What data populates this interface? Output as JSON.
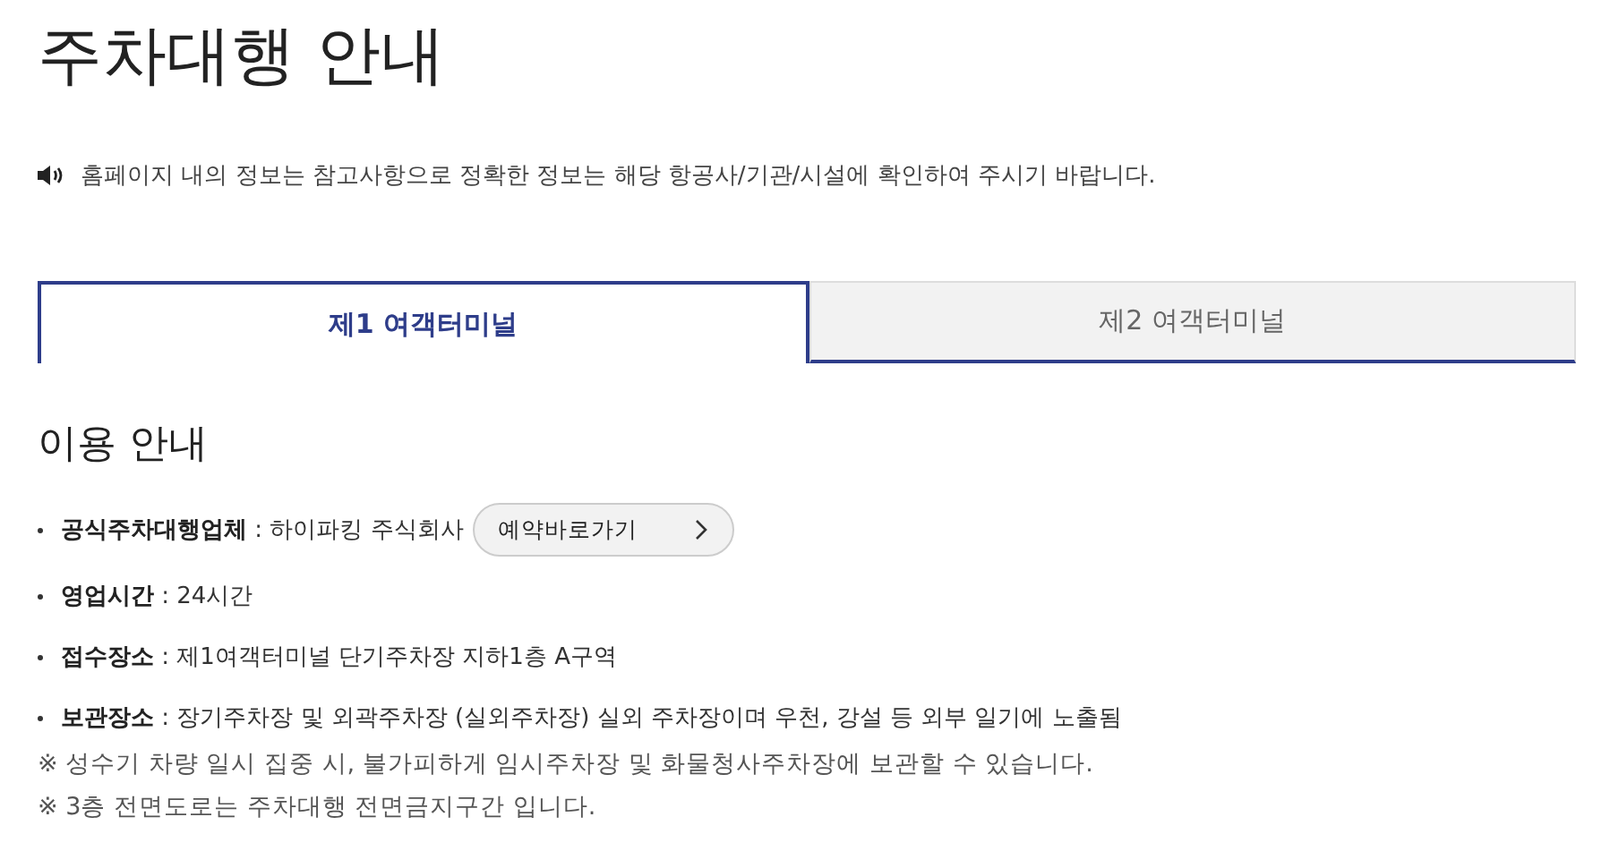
{
  "page": {
    "title": "주차대행 안내"
  },
  "notice": {
    "text": "홈페이지 내의 정보는 참고사항으로 정확한 정보는 해당 항공사/기관/시설에 확인하여 주시기 바랍니다."
  },
  "tabs": [
    {
      "label": "제1 여객터미널",
      "selected": true
    },
    {
      "label": "제2 여객터미널",
      "selected": false
    }
  ],
  "section": {
    "heading": "이용 안내",
    "items": [
      {
        "label": "공식주차대행업체",
        "value": " : 하이파킹 주식회사",
        "button": "예약바로가기"
      },
      {
        "label": "영업시간",
        "value": " : 24시간"
      },
      {
        "label": "접수장소",
        "value": " : 제1여객터미널 단기주차장 지하1층 A구역"
      },
      {
        "label": "보관장소",
        "value": " : 장기주차장 및 외곽주차장 (실외주차장) 실외 주차장이며 우천, 강설 등 외부 일기에 노출됨"
      }
    ],
    "notes": [
      "※ 성수기 차량 일시 집중 시, 불가피하게 임시주차장 및 화물청사주차장에 보관할 수 있습니다.",
      "※ 3층 전면도로는 주차대행 전면금지구간 입니다."
    ]
  }
}
